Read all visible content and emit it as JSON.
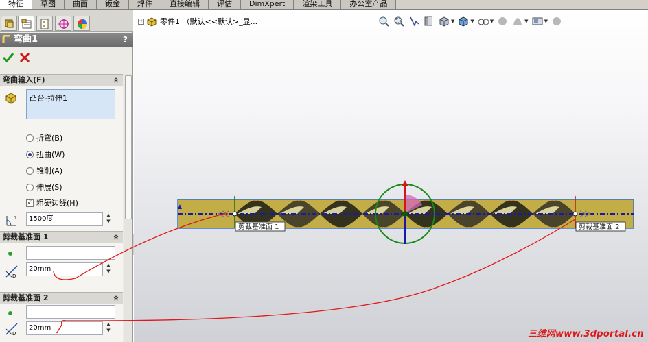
{
  "tabs": [
    "特征",
    "草图",
    "曲面",
    "钣金",
    "焊件",
    "直接编辑",
    "评估",
    "DimXpert",
    "渲染工具",
    "办公室产品"
  ],
  "active_tab": 0,
  "property_manager": {
    "title": "弯曲1",
    "help": "?",
    "icon_tabs": [
      "feature-manager-icon",
      "property-manager-icon",
      "configuration-manager-icon",
      "dimxpert-manager-icon",
      "display-manager-icon"
    ]
  },
  "bend_input": {
    "header": "弯曲输入(F)",
    "selected_body": "凸台-拉伸1",
    "options": [
      {
        "label": "折弯(B)",
        "checked": false
      },
      {
        "label": "扭曲(W)",
        "checked": true
      },
      {
        "label": "锥削(A)",
        "checked": false
      },
      {
        "label": "伸展(S)",
        "checked": false
      }
    ],
    "rigid_edges": {
      "label": "粗硬边线(H)",
      "checked": true
    },
    "angle": "1500度"
  },
  "trim_plane_1": {
    "header": "剪裁基准面 1",
    "reference": "",
    "distance": "20mm"
  },
  "trim_plane_2": {
    "header": "剪裁基准面 2",
    "reference": "",
    "distance": "20mm"
  },
  "tree": {
    "expand": "+",
    "root": "零件1 （默认<<默认>_显..."
  },
  "hud_icons": [
    {
      "icon": "zoom-to-fit-icon",
      "caret": false
    },
    {
      "icon": "zoom-to-area-icon",
      "caret": false
    },
    {
      "icon": "previous-view-icon",
      "caret": false
    },
    {
      "icon": "section-view-icon",
      "caret": false
    },
    {
      "icon": "view-orientation-icon",
      "caret": true
    },
    {
      "icon": "display-style-icon",
      "caret": true
    },
    {
      "icon": "hide-show-items-icon",
      "caret": true
    },
    {
      "icon": "edit-appearance-icon",
      "caret": false
    },
    {
      "icon": "apply-scene-icon",
      "caret": true
    },
    {
      "icon": "view-settings-icon",
      "caret": true
    },
    {
      "icon": "realview-icon",
      "caret": false
    }
  ],
  "plane_labels": {
    "left": "剪裁基准面 1",
    "right": "剪裁基准面 2"
  },
  "watermark": "三维网www.3dportal.cn",
  "colors": {
    "model": "#c8b44a",
    "dark_twist": "#34321c",
    "accent_red": "#e01818",
    "triad_green": "#178a17",
    "axis_blue": "#1a1aa6"
  }
}
